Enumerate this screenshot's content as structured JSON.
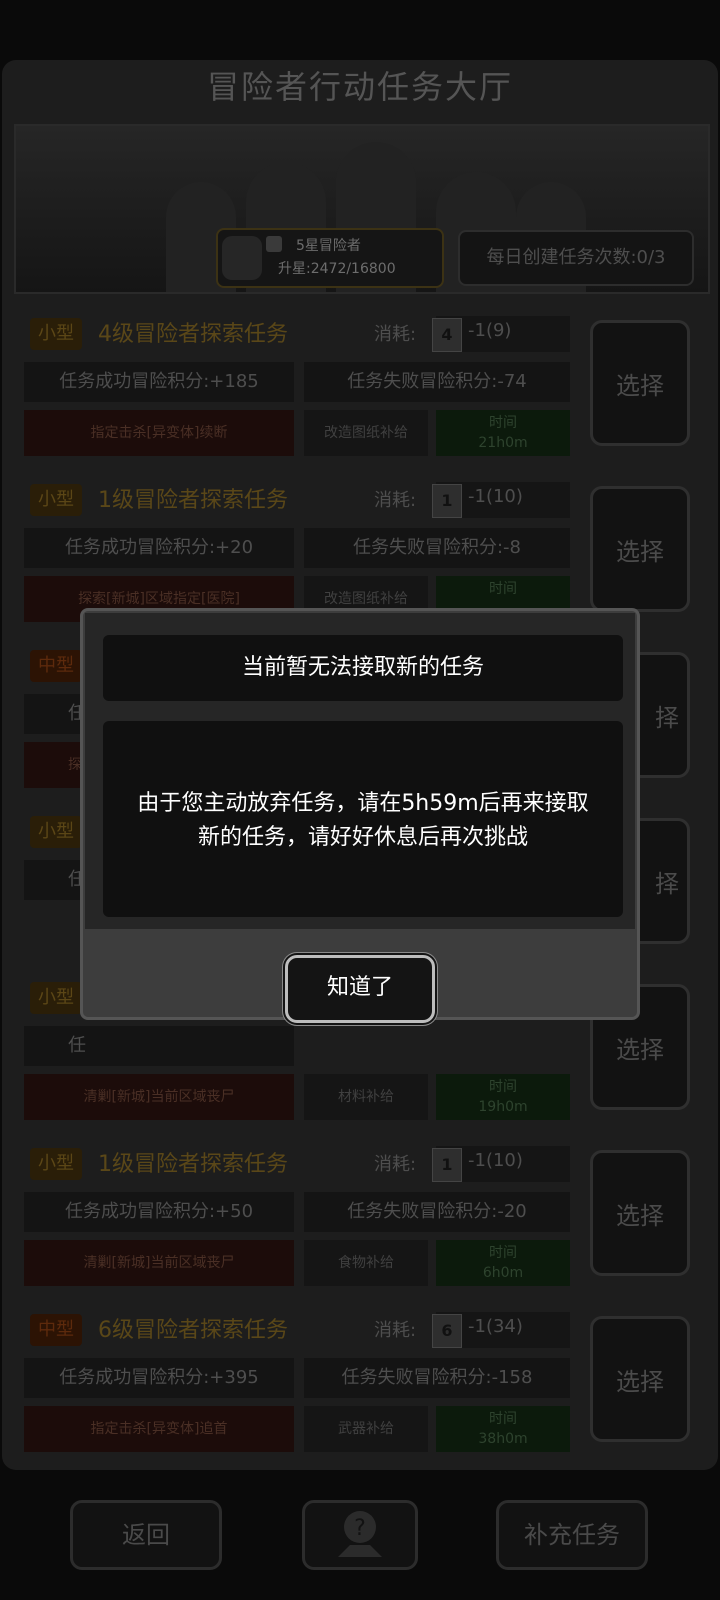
{
  "header": {
    "title": "冒险者行动任务大厅"
  },
  "rank": {
    "stars_label": "5星冒险者",
    "upgrade": "升星:2472/16800"
  },
  "daily": {
    "label": "每日创建任务次数:0/3"
  },
  "tasks": [
    {
      "size": "小型",
      "name": "4级冒险者探索任务",
      "cost_label": "消耗:",
      "card_level": "4",
      "cost": "-1(9)",
      "success": "任务成功冒险积分:+185",
      "fail": "任务失败冒险积分:-74",
      "objective": "指定击杀[异变体]续断",
      "supply": "改造图纸补给",
      "time_label": "时间",
      "time": "21h0m",
      "select": "选择"
    },
    {
      "size": "小型",
      "name": "1级冒险者探索任务",
      "cost_label": "消耗:",
      "card_level": "1",
      "cost": "-1(10)",
      "success": "任务成功冒险积分:+20",
      "fail": "任务失败冒险积分:-8",
      "objective": "探索[新城]区域指定[医院]",
      "supply": "改造图纸补给",
      "time_label": "时间",
      "time": "",
      "select": "选择"
    },
    {
      "size": "中型",
      "name": "",
      "cost_label": "",
      "card_level": "",
      "cost": "",
      "success": "任",
      "fail": "",
      "objective": "探",
      "supply": "",
      "time_label": "",
      "time": "",
      "select": "择"
    },
    {
      "size": "小型",
      "name": "",
      "cost_label": "",
      "card_level": "",
      "cost": "",
      "success": "任",
      "fail": "",
      "objective": "",
      "supply": "",
      "time_label": "",
      "time": "",
      "select": "择"
    },
    {
      "size": "小型",
      "name": "",
      "cost_label": "",
      "card_level": "",
      "cost": "",
      "success": "任",
      "fail": "",
      "objective": "清剿[新城]当前区域丧尸",
      "supply": "材料补给",
      "time_label": "时间",
      "time": "19h0m",
      "select": "选择"
    },
    {
      "size": "小型",
      "name": "1级冒险者探索任务",
      "cost_label": "消耗:",
      "card_level": "1",
      "cost": "-1(10)",
      "success": "任务成功冒险积分:+50",
      "fail": "任务失败冒险积分:-20",
      "objective": "清剿[新城]当前区域丧尸",
      "supply": "食物补给",
      "time_label": "时间",
      "time": "6h0m",
      "select": "选择"
    },
    {
      "size": "中型",
      "name": "6级冒险者探索任务",
      "cost_label": "消耗:",
      "card_level": "6",
      "cost": "-1(34)",
      "success": "任务成功冒险积分:+395",
      "fail": "任务失败冒险积分:-158",
      "objective": "指定击杀[异变体]追首",
      "supply": "武器补给",
      "time_label": "时间",
      "time": "38h0m",
      "select": "选择"
    }
  ],
  "bottom": {
    "back": "返回",
    "help_icon": "question-map-icon",
    "refill": "补充任务"
  },
  "dialog": {
    "title": "当前暂无法接取新的任务",
    "line1": "由于您主动放弃任务，请在5h59m后再来接取",
    "line2": "新的任务，请好好休息后再次挑战",
    "ok": "知道了"
  },
  "colors": {
    "accent_small": "#5b4616",
    "accent_mid": "#5d2a0c",
    "dialog_bg": "#3d3d3d"
  }
}
